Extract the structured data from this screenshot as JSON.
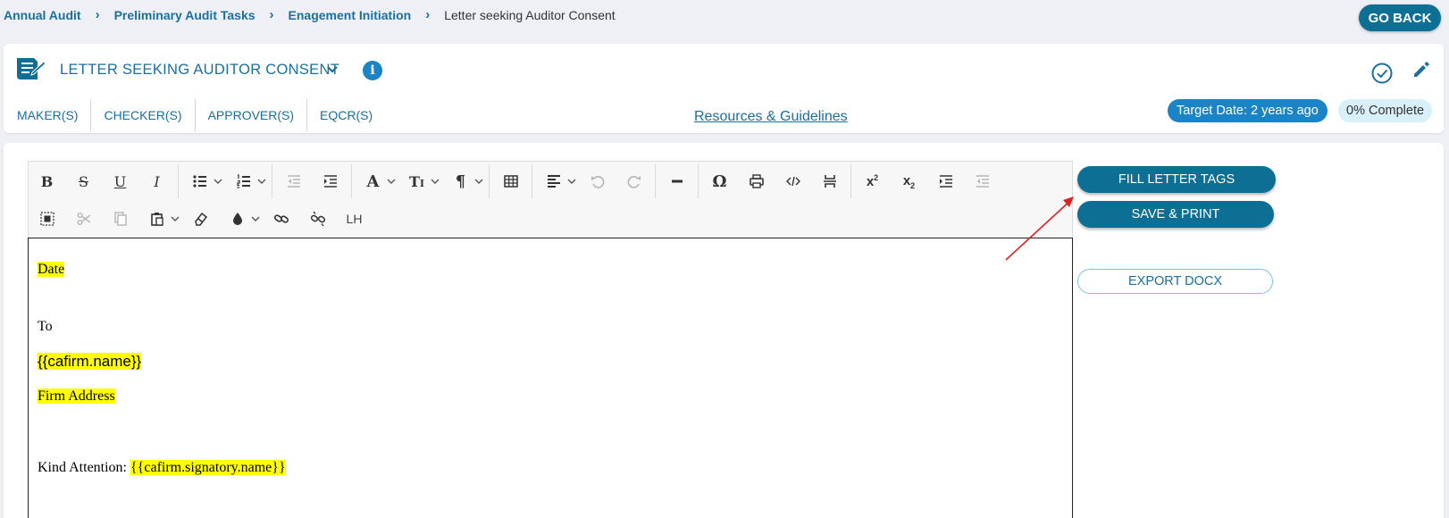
{
  "breadcrumb": {
    "items": [
      "Annual Audit",
      "Preliminary Audit Tasks",
      "Enagement Initiation"
    ],
    "current": "Letter seeking Auditor Consent"
  },
  "go_back_label": "GO BACK",
  "header": {
    "title": "LETTER SEEKING AUDITOR CONSENT",
    "info_glyph": "i",
    "tabs": [
      "MAKER(S)",
      "CHECKER(S)",
      "APPROVER(S)",
      "EQCR(S)"
    ],
    "resources_link": "Resources & Guidelines",
    "target_date": "Target Date: 2 years ago",
    "completion": "0% Complete",
    "icons": [
      "document-icon",
      "chevron-down-icon",
      "info-icon",
      "check-circle-icon",
      "pencil-icon"
    ]
  },
  "editor": {
    "toolbar_lh_label": "LH",
    "content": {
      "date": "Date",
      "to": "To",
      "firm_name_tag": "{{cafirm.name}}",
      "firm_address": "Firm Address",
      "kind_attention_label": "Kind Attention: ",
      "signatory_tag": "{{cafirm.signatory.name}}"
    }
  },
  "actions": {
    "fill_letter_tags": "FILL LETTER TAGS",
    "save_print": "SAVE & PRINT",
    "export_docx": "EXPORT DOCX"
  },
  "colors": {
    "accent": "#0d6f94",
    "link": "#1a6fa0",
    "badge_blue": "#1a84c7",
    "highlight": "#ffff00",
    "annotation_arrow": "#e02020"
  }
}
